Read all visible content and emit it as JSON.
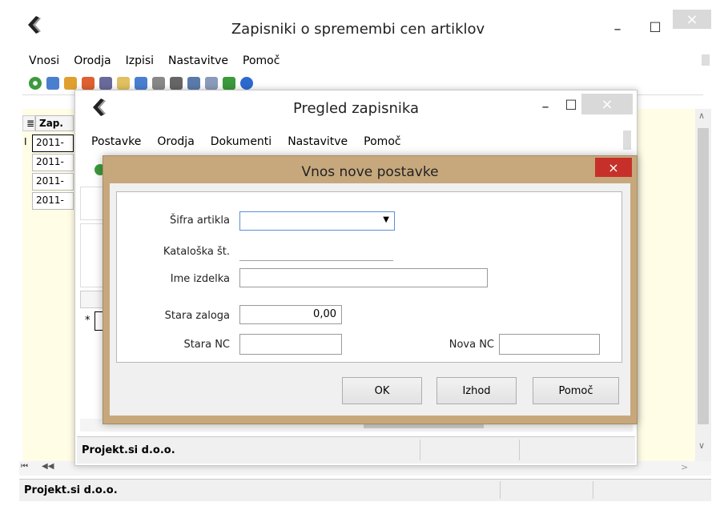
{
  "main": {
    "title": "Zapisniki o spremembi cen artiklov",
    "menu": [
      {
        "label": "Vnosi"
      },
      {
        "label": "Orodja"
      },
      {
        "label": "Izpisi"
      },
      {
        "label": "Nastavitve"
      },
      {
        "label": "Pomoč"
      }
    ],
    "grid_header": "Zap.",
    "row_indicator": "I",
    "rows": [
      "2011-",
      "2011-",
      "2011-",
      "2011-"
    ],
    "nav_first": "⏮",
    "nav_prev": "◀◀",
    "status": "Projekt.si d.o.o.",
    "buttons": {
      "minimize": "–",
      "maximize": "□",
      "close": "×"
    }
  },
  "pregled": {
    "title": "Pregled zapisnika",
    "menu": [
      {
        "label": "Postavke"
      },
      {
        "label": "Orodja"
      },
      {
        "label": "Dokumenti"
      },
      {
        "label": "Nastavitve"
      },
      {
        "label": "Pomoč"
      }
    ],
    "new_row_marker": "*",
    "status": "Projekt.si d.o.o.",
    "buttons": {
      "minimize": "–",
      "maximize": "□",
      "close": "×"
    }
  },
  "dialog": {
    "title": "Vnos nove postavke",
    "close": "×",
    "fields": {
      "sifra_label": "Šifra artikla",
      "sifra_value": "",
      "kataloska_label": "Kataloška št.",
      "kataloska_value": "",
      "ime_label": "Ime izdelka",
      "ime_value": "",
      "stara_zaloga_label": "Stara zaloga",
      "stara_zaloga_value": "0,00",
      "stara_nc_label": "Stara NC",
      "stara_nc_value": "",
      "nova_nc_label": "Nova NC",
      "nova_nc_value": ""
    },
    "buttons": {
      "ok": "OK",
      "izhod": "Izhod",
      "pomoc": "Pomoč"
    }
  },
  "colors": {
    "dialog_frame": "#c7a87d",
    "close_red": "#c7302a",
    "content_yellow": "#fffde6",
    "status_bg": "#f0f0f0"
  }
}
